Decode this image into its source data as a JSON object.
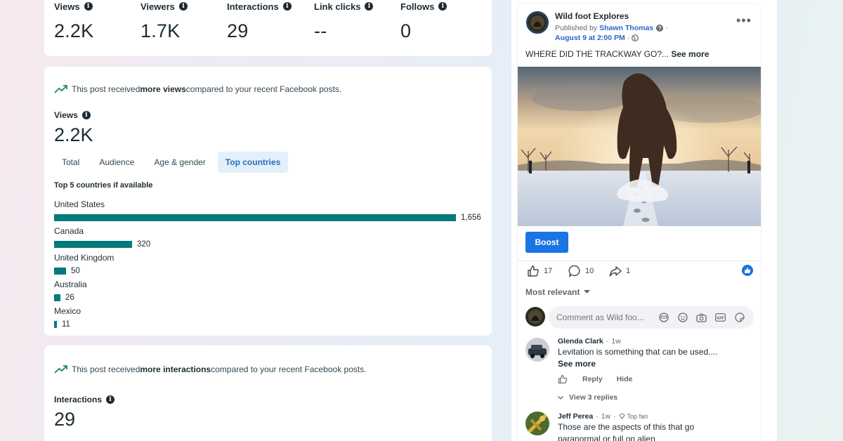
{
  "metrics": [
    {
      "label": "Views",
      "value": "2.2K"
    },
    {
      "label": "Viewers",
      "value": "1.7K"
    },
    {
      "label": "Interactions",
      "value": "29"
    },
    {
      "label": "Link clicks",
      "value": "--"
    },
    {
      "label": "Follows",
      "value": "0"
    }
  ],
  "views_card": {
    "notice_pre": "This post received ",
    "notice_bold": "more views",
    "notice_post": " compared to your recent Facebook posts.",
    "label": "Views",
    "value": "2.2K",
    "tabs": [
      "Total",
      "Audience",
      "Age & gender",
      "Top countries"
    ],
    "active_tab": "Top countries",
    "countries_title": "Top 5 countries if available",
    "countries": [
      {
        "name": "United States",
        "value": 1656,
        "display": "1,656"
      },
      {
        "name": "Canada",
        "value": 320,
        "display": "320"
      },
      {
        "name": "United Kingdom",
        "value": 50,
        "display": "50"
      },
      {
        "name": "Australia",
        "value": 26,
        "display": "26"
      },
      {
        "name": "Mexico",
        "value": 11,
        "display": "11"
      }
    ]
  },
  "interactions_card": {
    "notice_pre": "This post received ",
    "notice_bold": "more interactions",
    "notice_post": " compared to your recent Facebook posts.",
    "label": "Interactions",
    "value": "29"
  },
  "post": {
    "page_name": "Wild foot Explores",
    "published_by_prefix": "Published by",
    "publisher": "Shawn Thomas",
    "date": "August 9 at 2:00 PM",
    "text": "WHERE DID THE TRACKWAY GO?...",
    "see_more": "See more",
    "boost_label": "Boost",
    "likes": "17",
    "comments": "10",
    "shares": "1",
    "sort_label": "Most relevant",
    "comment_placeholder": "Comment as Wild foo...",
    "comments_list": [
      {
        "name": "Glenda Clark",
        "ago": "1w",
        "text": "Levitation is something that can be used....",
        "see_more": "See more",
        "reply": "Reply",
        "hide": "Hide",
        "view_replies": "View 3 replies"
      },
      {
        "name": "Jeff Perea",
        "ago": "1w",
        "badge": "Top fan",
        "text": "Those are the aspects of this that go paranormal or full on alien"
      }
    ]
  },
  "colors": {
    "bar": "#047a7c",
    "accent_blue": "#1b74e4",
    "tab_active_bg": "#e3f0fb",
    "trend_green": "#1f8a56"
  }
}
